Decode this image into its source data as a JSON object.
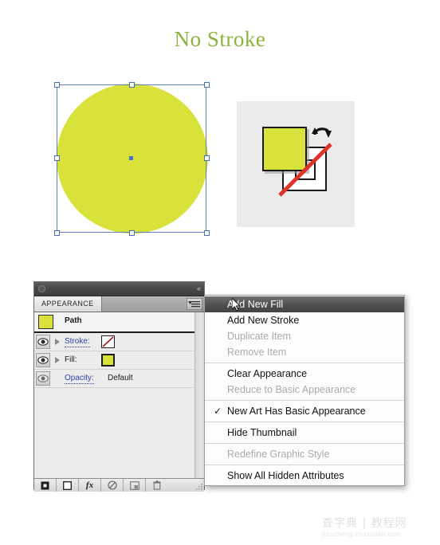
{
  "page": {
    "title": "No Stroke",
    "title_color": "#8cb33f",
    "background": "#ffffff"
  },
  "artwork": {
    "shape_name": "circle-path",
    "fill_color": "#d9e13b",
    "stroke": "none",
    "selection_color": "#4a6fb5",
    "handles": 8
  },
  "fill_stroke_indicator": {
    "fill_color": "#d9e13b",
    "stroke_color": "none",
    "none_slash_color": "#e03228",
    "swap_icon": "swap-fill-stroke-icon",
    "background": "#ebebeb"
  },
  "panel": {
    "title_bar": {
      "close_icon": "close-dot-icon",
      "collapse_icon": "collapse-arrows-icon",
      "collapse_glyph": "«"
    },
    "tab_label": "APPEARANCE",
    "menu_button_icon": "panel-menu-icon",
    "rows": [
      {
        "id": "path",
        "label": "Path",
        "has_thumbnail": true,
        "thumb_color": "#d9e13b"
      },
      {
        "id": "stroke",
        "label": "Stroke:",
        "link": true,
        "swatch": "none",
        "visibility_icon": "eye-icon",
        "disclosure_icon": "disclosure-triangle-icon"
      },
      {
        "id": "fill",
        "label": "Fill:",
        "link": false,
        "swatch": "#d9e13b",
        "visibility_icon": "eye-icon",
        "disclosure_icon": "disclosure-triangle-icon"
      },
      {
        "id": "opacity",
        "label": "Opacity:",
        "link": true,
        "value": "Default",
        "visibility_icon": "eye-icon"
      }
    ],
    "footer_buttons": [
      {
        "name": "add-new-stroke-button",
        "icon": "filled-square-icon"
      },
      {
        "name": "add-new-fill-button",
        "icon": "empty-square-icon"
      },
      {
        "name": "add-new-effect-button",
        "icon": "fx-icon",
        "label": "fx"
      },
      {
        "name": "clear-appearance-button",
        "icon": "no-symbol-icon"
      },
      {
        "name": "duplicate-item-button",
        "icon": "duplicate-icon"
      },
      {
        "name": "delete-item-button",
        "icon": "trash-icon"
      }
    ],
    "resize_grip_icon": "resize-grip-icon"
  },
  "context_menu": {
    "items": [
      {
        "label": "Add New Fill",
        "state": "highlighted"
      },
      {
        "label": "Add New Stroke",
        "state": "enabled"
      },
      {
        "label": "Duplicate Item",
        "state": "disabled"
      },
      {
        "label": "Remove Item",
        "state": "disabled"
      },
      {
        "separator": true
      },
      {
        "label": "Clear Appearance",
        "state": "enabled"
      },
      {
        "label": "Reduce to Basic Appearance",
        "state": "disabled"
      },
      {
        "separator": true
      },
      {
        "label": "New Art Has Basic Appearance",
        "state": "enabled",
        "checked": true
      },
      {
        "separator": true
      },
      {
        "label": "Hide Thumbnail",
        "state": "enabled"
      },
      {
        "separator": true
      },
      {
        "label": "Redefine Graphic Style",
        "state": "disabled"
      },
      {
        "separator": true
      },
      {
        "label": "Show All Hidden Attributes",
        "state": "enabled"
      }
    ],
    "cursor_icon": "mouse-pointer-icon"
  },
  "watermark": {
    "cn_text": "查字典 | 教程网",
    "url_text": "jiaocheng.chazidian.com"
  }
}
